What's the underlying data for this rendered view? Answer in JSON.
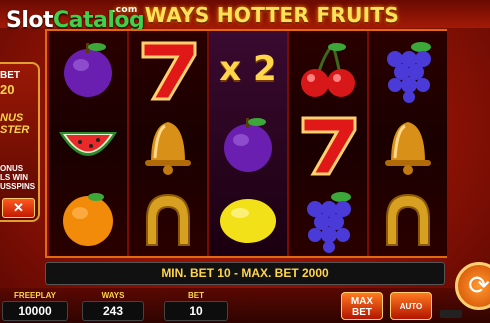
{
  "watermark": {
    "slot": "Slot",
    "catalog": "Catalog",
    "com": ".com"
  },
  "title": "WAYS HOTTER FRUITS",
  "reels": [
    [
      "plum",
      "watermelon",
      "orange"
    ],
    [
      "seven",
      "bell",
      "horseshoe"
    ],
    [
      "x2",
      "plum",
      "lemon"
    ],
    [
      "cherry",
      "seven",
      "grapes"
    ],
    [
      "grapes",
      "bell",
      "horseshoe"
    ]
  ],
  "multiplier_label": "x 2",
  "side_panel": {
    "bet_label": "BET",
    "bet_value": "20",
    "bonus_line1": "NUS",
    "bonus_line2": "STER",
    "desc_line1": "ONUS",
    "desc_line2": "LS WIN",
    "desc_line3": "USSPINS",
    "close_label": "✕"
  },
  "info_text": "MIN. BET 10 - MAX. BET 2000",
  "stats": {
    "freeplay_label": "FREEPLAY",
    "freeplay_value": "10000",
    "ways_label": "WAYS",
    "ways_value": "243",
    "bet_label": "BET",
    "bet_value": "10"
  },
  "buttons": {
    "maxbet_line1": "MAX",
    "maxbet_line2": "BET",
    "auto_label": "AUTO",
    "spin_icon": "spin-arrow-icon"
  }
}
